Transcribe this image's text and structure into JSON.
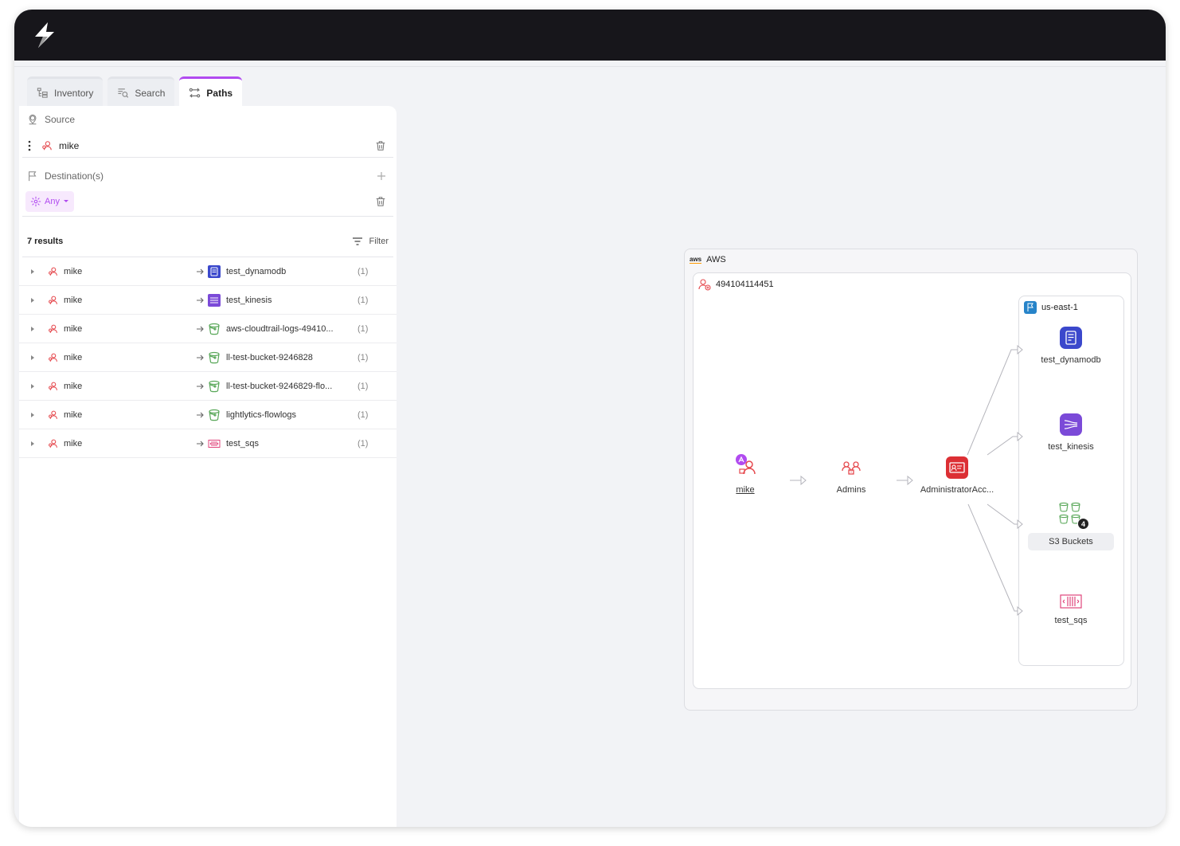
{
  "tabs": [
    {
      "label": "Inventory",
      "icon": "inventory-icon",
      "active": false
    },
    {
      "label": "Search",
      "icon": "search-icon",
      "active": false
    },
    {
      "label": "Paths",
      "icon": "paths-icon",
      "active": true
    }
  ],
  "source": {
    "heading": "Source",
    "value": "mike"
  },
  "destination": {
    "heading": "Destination(s)",
    "any_label": "Any"
  },
  "results": {
    "count_label": "7 results",
    "filter_label": "Filter",
    "rows": [
      {
        "source": "mike",
        "dest": "test_dynamodb",
        "dest_icon": "dynamodb-icon",
        "count": "(1)"
      },
      {
        "source": "mike",
        "dest": "test_kinesis",
        "dest_icon": "kinesis-icon",
        "count": "(1)"
      },
      {
        "source": "mike",
        "dest": "aws-cloudtrail-logs-49410...",
        "dest_icon": "s3-bucket-icon",
        "count": "(1)"
      },
      {
        "source": "mike",
        "dest": "ll-test-bucket-9246828",
        "dest_icon": "s3-bucket-icon",
        "count": "(1)"
      },
      {
        "source": "mike",
        "dest": "ll-test-bucket-9246829-flo...",
        "dest_icon": "s3-bucket-icon",
        "count": "(1)"
      },
      {
        "source": "mike",
        "dest": "lightlytics-flowlogs",
        "dest_icon": "s3-bucket-icon",
        "count": "(1)"
      },
      {
        "source": "mike",
        "dest": "test_sqs",
        "dest_icon": "sqs-icon",
        "count": "(1)"
      }
    ]
  },
  "graph": {
    "cloud_logo": "aws",
    "cloud_label": "AWS",
    "account": "494104114451",
    "region": "us-east-1",
    "nodes": {
      "mike": "mike",
      "admins": "Admins",
      "role": "AdministratorAcc...",
      "dynamodb": "test_dynamodb",
      "kinesis": "test_kinesis",
      "s3": "S3 Buckets",
      "s3_count": "4",
      "sqs": "test_sqs"
    }
  },
  "colors": {
    "accent": "#b14bf0",
    "user": "#e5484d",
    "dynamodb": "#3b48cc",
    "kinesis": "#7b4ad8",
    "s3": "#5aa85a",
    "sqs": "#e0457b",
    "role": "#dc2f34"
  }
}
